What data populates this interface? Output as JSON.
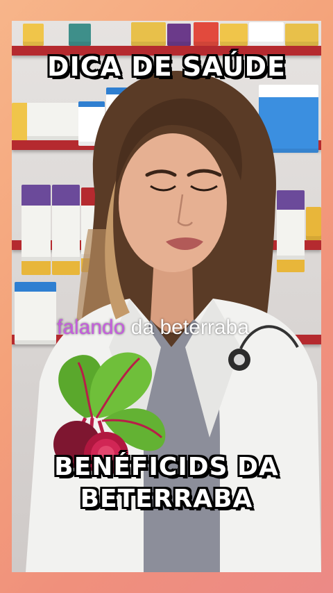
{
  "header": {
    "title": "DICA DE SAÚDE"
  },
  "caption": {
    "highlight": "falando",
    "rest": "da beterraba"
  },
  "footer": {
    "line1": "BENÉFICIDS DA",
    "line2": "BETERRABA"
  },
  "colors": {
    "accent_purple": "#c45ddc",
    "shelf_red": "#b52a2f",
    "border_gradient": "#f4a27a"
  },
  "icons": {
    "beet": "beetroot-sticker"
  }
}
